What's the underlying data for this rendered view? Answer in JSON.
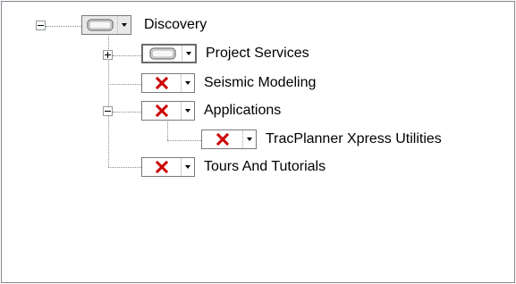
{
  "tree": {
    "root": {
      "label": "Discovery",
      "icon": "device-icon",
      "expanded": true,
      "children": [
        {
          "label": "Project Services",
          "icon": "device-icon",
          "expanded": false
        },
        {
          "label": "Seismic Modeling",
          "icon": "red-x-icon"
        },
        {
          "label": "Applications",
          "icon": "red-x-icon",
          "expanded": true,
          "children": [
            {
              "label": "TracPlanner Xpress Utilities",
              "icon": "red-x-icon"
            }
          ]
        },
        {
          "label": "Tours And Tutorials",
          "icon": "red-x-icon"
        }
      ]
    }
  },
  "colors": {
    "error_x": "#cc0000",
    "border": "#828790",
    "connector": "#8a8a8a"
  }
}
